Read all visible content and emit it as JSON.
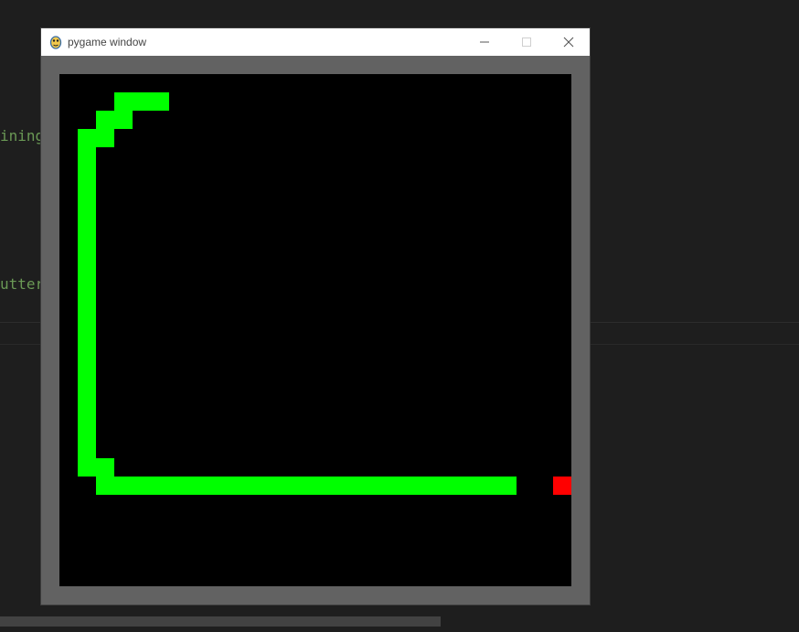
{
  "editor": {
    "lines": [
      {
        "text": "ining"
      },
      {
        "text": "utter"
      }
    ],
    "text_color": "#6a9955",
    "background_color": "#1e1e1e"
  },
  "window": {
    "title": "pygame window",
    "icon": "pygame-snake-icon",
    "controls": [
      {
        "name": "minimize-button",
        "icon": "minimize-icon"
      },
      {
        "name": "maximize-button",
        "icon": "maximize-icon"
      },
      {
        "name": "close-button",
        "icon": "close-icon"
      }
    ]
  },
  "game": {
    "border_color": "#626262",
    "field_color": "#000000",
    "snake_color": "#00ff00",
    "food_color": "#ff0000",
    "cols": 28,
    "rows": 28,
    "snake": [
      [
        3,
        1
      ],
      [
        4,
        1
      ],
      [
        5,
        1
      ],
      [
        2,
        2
      ],
      [
        3,
        2
      ],
      [
        1,
        3
      ],
      [
        2,
        3
      ],
      [
        1,
        4
      ],
      [
        1,
        5
      ],
      [
        1,
        6
      ],
      [
        1,
        7
      ],
      [
        1,
        8
      ],
      [
        1,
        9
      ],
      [
        1,
        10
      ],
      [
        1,
        11
      ],
      [
        1,
        12
      ],
      [
        1,
        13
      ],
      [
        1,
        14
      ],
      [
        1,
        15
      ],
      [
        1,
        16
      ],
      [
        1,
        17
      ],
      [
        1,
        18
      ],
      [
        1,
        19
      ],
      [
        1,
        20
      ],
      [
        1,
        21
      ],
      [
        2,
        21
      ],
      [
        2,
        22
      ],
      [
        3,
        22
      ],
      [
        4,
        22
      ],
      [
        5,
        22
      ],
      [
        6,
        22
      ],
      [
        7,
        22
      ],
      [
        8,
        22
      ],
      [
        9,
        22
      ],
      [
        10,
        22
      ],
      [
        11,
        22
      ],
      [
        12,
        22
      ],
      [
        13,
        22
      ],
      [
        14,
        22
      ],
      [
        15,
        22
      ],
      [
        16,
        22
      ],
      [
        17,
        22
      ],
      [
        18,
        22
      ],
      [
        19,
        22
      ],
      [
        20,
        22
      ],
      [
        21,
        22
      ],
      [
        22,
        22
      ],
      [
        23,
        22
      ],
      [
        24,
        22
      ]
    ],
    "food": [
      27,
      22
    ]
  }
}
